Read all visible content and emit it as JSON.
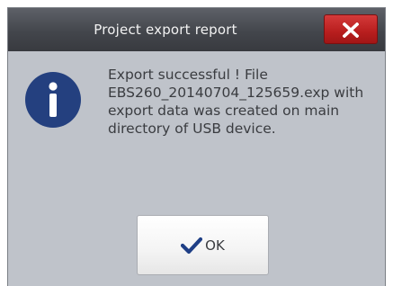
{
  "dialog": {
    "title": "Project export report",
    "close_icon": "close-icon",
    "info_icon": "info-icon",
    "message_lines": [
      "Export successful ! File",
      "EBS260_20140704_125659.exp with",
      "export data was created on main",
      "directory of USB device."
    ],
    "ok_label": "OK",
    "ok_icon": "checkmark-icon"
  },
  "colors": {
    "titlebar": "#43464c",
    "close_button": "#b81e1e",
    "body": "#bfc3ca",
    "info_icon": "#24407f",
    "checkmark": "#1f3f86"
  }
}
